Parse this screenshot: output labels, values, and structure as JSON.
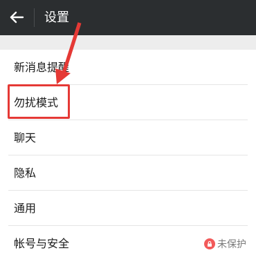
{
  "header": {
    "title": "设置",
    "back_icon": "arrow-left-icon"
  },
  "settings": {
    "items": [
      {
        "label": "新消息提醒"
      },
      {
        "label": "勿扰模式"
      },
      {
        "label": "聊天"
      },
      {
        "label": "隐私"
      },
      {
        "label": "通用"
      },
      {
        "label": "帐号与安全",
        "status": "未保护",
        "status_icon": "lock-icon"
      }
    ]
  },
  "annotation": {
    "color": "#e53935"
  }
}
